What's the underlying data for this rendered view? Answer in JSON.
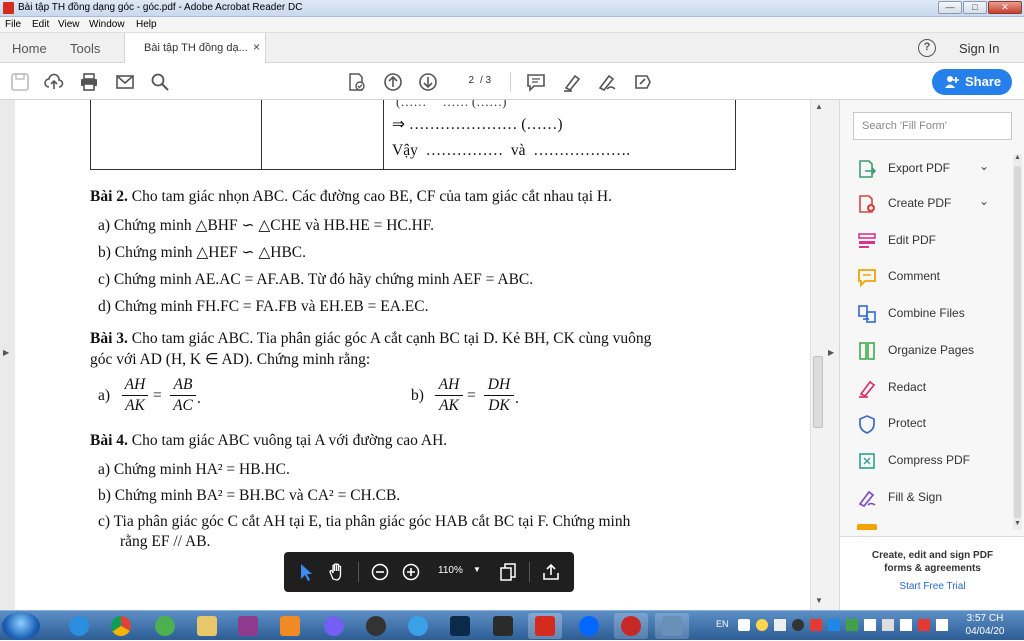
{
  "window": {
    "title": "Bài tập TH đồng dạng góc - góc.pdf - Adobe Acrobat Reader DC",
    "min": "—",
    "max": "□",
    "close": "✕"
  },
  "menu": [
    "File",
    "Edit",
    "View",
    "Window",
    "Help"
  ],
  "tabs": {
    "home": "Home",
    "tools": "Tools",
    "doc": "Bài tập TH đồng dạ...",
    "doc_close": "×",
    "help": "?",
    "signin": "Sign In"
  },
  "toolbar": {
    "page_current": "2",
    "page_total": "/ 3",
    "share": "Share"
  },
  "document": {
    "table_row1": "⇒ ………………… (……)",
    "table_row2_prefix": "Vậy",
    "table_row2_dots1": "……………",
    "table_row2_and": "và",
    "table_row2_dots2": "………………",
    "bai2_title": "Bài 2.",
    "bai2_text": "Cho tam giác nhọn ABC. Các đường cao BE, CF của tam giác cắt nhau tại H.",
    "bai2_a": "a) Chứng minh △BHF ∽ △CHE và HB.HE = HC.HF.",
    "bai2_b": "b) Chứng minh △HEF ∽ △HBC.",
    "bai2_c": "c) Chứng minh AE.AC = AF.AB. Từ đó hãy chứng minh AEF = ABC.",
    "bai2_d": "d) Chứng minh FH.FC = FA.FB và EH.EB = EA.EC.",
    "bai3_title": "Bài 3.",
    "bai3_text1": "Cho tam giác ABC. Tia phân giác góc A cắt cạnh BC tại D. Kẻ BH, CK cùng vuông",
    "bai3_text2": "góc với AD (H, K ∈ AD). Chứng minh rằng:",
    "bai3_a_label": "a)",
    "bai3_a_num1": "AH",
    "bai3_a_den1": "AK",
    "bai3_a_num2": "AB",
    "bai3_a_den2": "AC",
    "bai3_b_label": "b)",
    "bai3_b_num1": "AH",
    "bai3_b_den1": "AK",
    "bai3_b_num2": "DH",
    "bai3_b_den2": "DK",
    "bai4_title": "Bài 4.",
    "bai4_text": "Cho tam giác ABC vuông tại A với đường cao AH.",
    "bai4_a": "a) Chứng minh HA² = HB.HC.",
    "bai4_b": "b) Chứng minh BA² = BH.BC và CA² = CH.CB.",
    "bai4_c1": "c) Tia phân giác góc C cắt AH tại E, tia phân giác góc HAB cắt BC tại F. Chứng minh",
    "bai4_c2": "rằng EF // AB."
  },
  "float_toolbar": {
    "zoom": "110%"
  },
  "right_panel": {
    "search_placeholder": "Search 'Fill Form'",
    "items": [
      {
        "label": "Export PDF",
        "color": "#3a9e6e"
      },
      {
        "label": "Create PDF",
        "color": "#d64545"
      },
      {
        "label": "Edit PDF",
        "color": "#d9348c"
      },
      {
        "label": "Comment",
        "color": "#f0a500"
      },
      {
        "label": "Combine Files",
        "color": "#3468d8"
      },
      {
        "label": "Organize Pages",
        "color": "#3fae49"
      },
      {
        "label": "Redact",
        "color": "#d6346b"
      },
      {
        "label": "Protect",
        "color": "#3a6bc8"
      },
      {
        "label": "Compress PDF",
        "color": "#2ba38e"
      },
      {
        "label": "Fill & Sign",
        "color": "#7b4fc7"
      }
    ],
    "promo_text": "Create, edit and sign PDF forms & agreements",
    "promo_link": "Start Free Trial"
  },
  "taskbar": {
    "lang": "EN",
    "time": "3:57 CH",
    "date": "04/04/20"
  }
}
